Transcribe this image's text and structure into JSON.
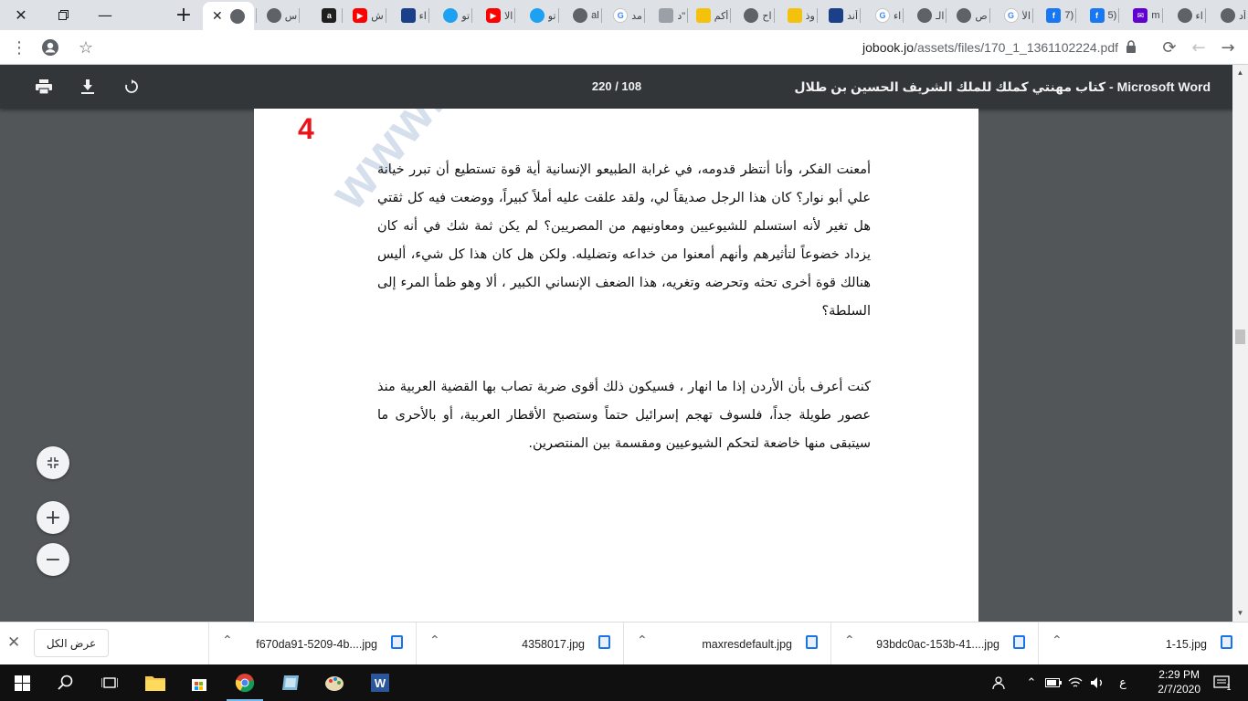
{
  "browser": {
    "tabs": [
      {
        "label": "أد",
        "icon": "globe-icon"
      },
      {
        "label": "اء",
        "icon": "globe-icon"
      },
      {
        "label": "m",
        "icon": "yahoo-mail-icon"
      },
      {
        "label": "(5",
        "icon": "facebook-icon"
      },
      {
        "label": "(7",
        "icon": "facebook-icon"
      },
      {
        "label": "الأ",
        "icon": "google-icon"
      },
      {
        "label": "ص",
        "icon": "globe-icon"
      },
      {
        "label": "الـ",
        "icon": "globe-icon"
      },
      {
        "label": "اء",
        "icon": "google-icon"
      },
      {
        "label": "أند",
        "icon": "news-icon"
      },
      {
        "label": "وذ",
        "icon": "bookmark-icon"
      },
      {
        "label": "اح",
        "icon": "globe-icon"
      },
      {
        "label": "أكم",
        "icon": "yellow-icon"
      },
      {
        "label": "\"د",
        "icon": "plain-icon"
      },
      {
        "label": "مد",
        "icon": "google-icon"
      },
      {
        "label": "al",
        "icon": "globe-icon"
      },
      {
        "label": "تو",
        "icon": "twitter-icon"
      },
      {
        "label": "الا",
        "icon": "youtube-icon"
      },
      {
        "label": "تو",
        "icon": "twitter-icon"
      },
      {
        "label": "اء",
        "icon": "news-icon"
      },
      {
        "label": "ش",
        "icon": "youtube-icon"
      },
      {
        "label": "",
        "icon": "dark-icon"
      },
      {
        "label": "س",
        "icon": "globe-icon"
      }
    ],
    "url_host": "jobook.jo",
    "url_path": "/assets/files/170_1_1361102224.pdf",
    "url_full": "jobook.jo/assets/files/170_1_1361102224.pdf"
  },
  "pdf": {
    "title": "Microsoft Word - كتاب مهنتي كملك للملك الشريف الحسين بن طلال",
    "page_indicator": "220 / 108",
    "page_number": "4",
    "watermark": "www.rahi-ha",
    "paragraphs": [
      "أمعنت الفكر، وأنا أنتظر قدومه، في غرابة الطبيعو الإنسانية أية قوة تستطيع أن تبرر خيانة علي أبو نوار؟ كان هذا الرجل صديقاً لي، ولقد علقت عليه أملاً كبيراً، ووضعت فيه كل ثقتي هل تغير لأنه استسلم للشيوعيين ومعاونيهم من المصريين؟ لم يكن ثمة شك في أنه كان يزداد خضوعاً لتأثيرهم وأنهم أمعنوا من خداعه وتضليله. ولكن هل كان هذا كل شيء، أليس هنالك قوة أخرى تحثه وتحرضه وتغريه، هذا الضعف الإنساني الكبير ، ألا وهو ظمأ المرء إلى السلطة؟",
      "كنت أعرف بأن الأردن إذا ما انهار ، فسيكون ذلك أقوى ضربة تصاب بها القضية العربية منذ عصور طويلة جداً، فلسوف تهجم إسرائيل حتماً وستصبح الأقطار العربية، أو بالأحرى ما سيتبقى منها خاضعة لتحكم الشيوعيين ومقسمة بين المنتصرين."
    ]
  },
  "downloads": {
    "show_all_label": "عرض الكل",
    "items": [
      {
        "name": "f670da91-5209-4b....jpg"
      },
      {
        "name": "4358017.jpg"
      },
      {
        "name": "maxresdefault.jpg"
      },
      {
        "name": "93bdc0ac-153b-41....jpg"
      },
      {
        "name": "1-15.jpg"
      }
    ]
  },
  "taskbar": {
    "time": "2:29 PM",
    "date": "2/7/2020",
    "lang": "ع",
    "notif_count": "1"
  }
}
